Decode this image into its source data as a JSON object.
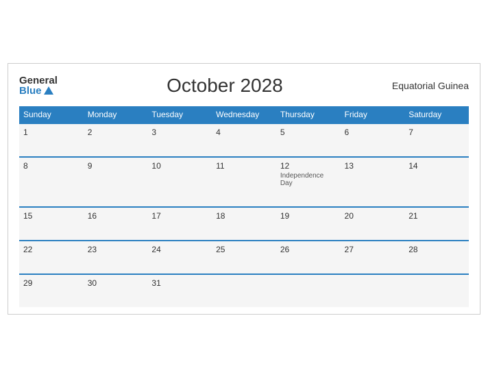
{
  "logo": {
    "general": "General",
    "blue": "Blue"
  },
  "header": {
    "title": "October 2028",
    "country": "Equatorial Guinea"
  },
  "weekdays": [
    "Sunday",
    "Monday",
    "Tuesday",
    "Wednesday",
    "Thursday",
    "Friday",
    "Saturday"
  ],
  "weeks": [
    [
      {
        "day": "1",
        "event": ""
      },
      {
        "day": "2",
        "event": ""
      },
      {
        "day": "3",
        "event": ""
      },
      {
        "day": "4",
        "event": ""
      },
      {
        "day": "5",
        "event": ""
      },
      {
        "day": "6",
        "event": ""
      },
      {
        "day": "7",
        "event": ""
      }
    ],
    [
      {
        "day": "8",
        "event": ""
      },
      {
        "day": "9",
        "event": ""
      },
      {
        "day": "10",
        "event": ""
      },
      {
        "day": "11",
        "event": ""
      },
      {
        "day": "12",
        "event": "Independence Day"
      },
      {
        "day": "13",
        "event": ""
      },
      {
        "day": "14",
        "event": ""
      }
    ],
    [
      {
        "day": "15",
        "event": ""
      },
      {
        "day": "16",
        "event": ""
      },
      {
        "day": "17",
        "event": ""
      },
      {
        "day": "18",
        "event": ""
      },
      {
        "day": "19",
        "event": ""
      },
      {
        "day": "20",
        "event": ""
      },
      {
        "day": "21",
        "event": ""
      }
    ],
    [
      {
        "day": "22",
        "event": ""
      },
      {
        "day": "23",
        "event": ""
      },
      {
        "day": "24",
        "event": ""
      },
      {
        "day": "25",
        "event": ""
      },
      {
        "day": "26",
        "event": ""
      },
      {
        "day": "27",
        "event": ""
      },
      {
        "day": "28",
        "event": ""
      }
    ],
    [
      {
        "day": "29",
        "event": ""
      },
      {
        "day": "30",
        "event": ""
      },
      {
        "day": "31",
        "event": ""
      },
      {
        "day": "",
        "event": ""
      },
      {
        "day": "",
        "event": ""
      },
      {
        "day": "",
        "event": ""
      },
      {
        "day": "",
        "event": ""
      }
    ]
  ]
}
